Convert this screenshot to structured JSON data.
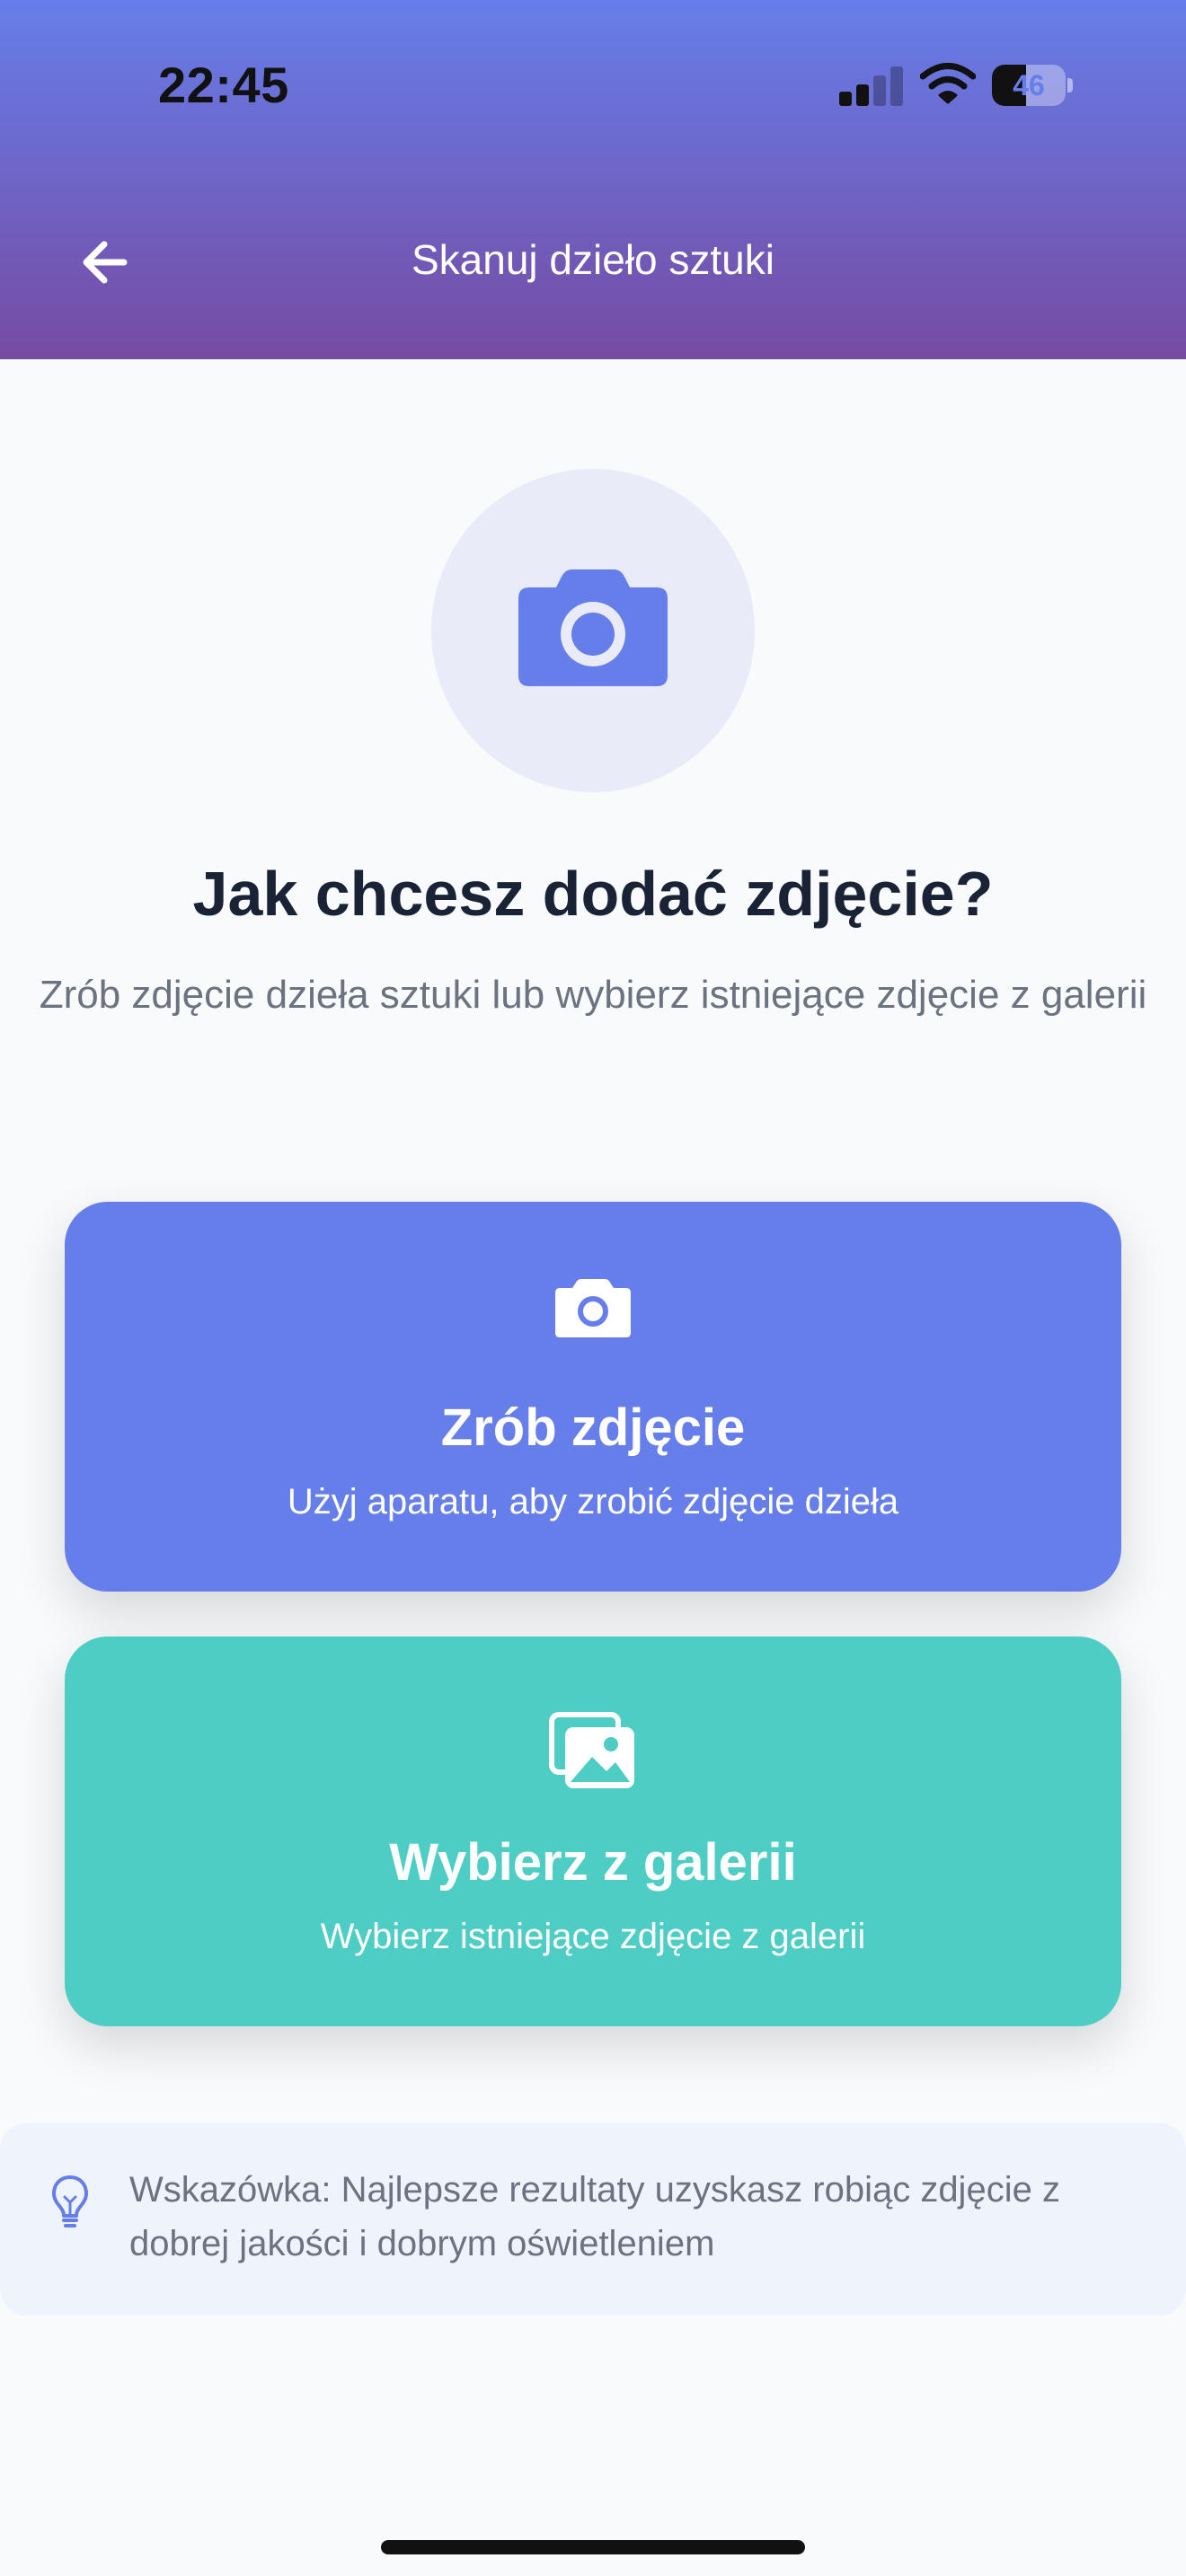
{
  "status_bar": {
    "time": "22:45",
    "battery_level": 46,
    "battery_text": "46"
  },
  "nav": {
    "title": "Skanuj dzieło sztuki",
    "back_icon": "arrow-left-icon"
  },
  "hero": {
    "icon": "camera-icon"
  },
  "main": {
    "heading": "Jak chcesz dodać zdjęcie?",
    "subtitle": "Zrób zdjęcie dzieła sztuki lub wybierz istniejące zdjęcie z galerii"
  },
  "options": [
    {
      "title": "Zrób zdjęcie",
      "description": "Użyj aparatu, aby zrobić zdjęcie dzieła",
      "icon": "camera-icon",
      "color": "#667eea"
    },
    {
      "title": "Wybierz z galerii",
      "description": "Wybierz istniejące zdjęcie z galerii",
      "icon": "images-icon",
      "color": "#4ecdc4"
    }
  ],
  "tip": {
    "icon": "lightbulb-icon",
    "text": "Wskazówka: Najlepsze rezultaty uzyskasz robiąc zdjęcie z dobrej jakości i dobrym oświetleniem"
  },
  "colors": {
    "header_gradient_start": "#667eea",
    "header_gradient_end": "#764ba2",
    "primary": "#667eea",
    "secondary": "#4ecdc4"
  }
}
